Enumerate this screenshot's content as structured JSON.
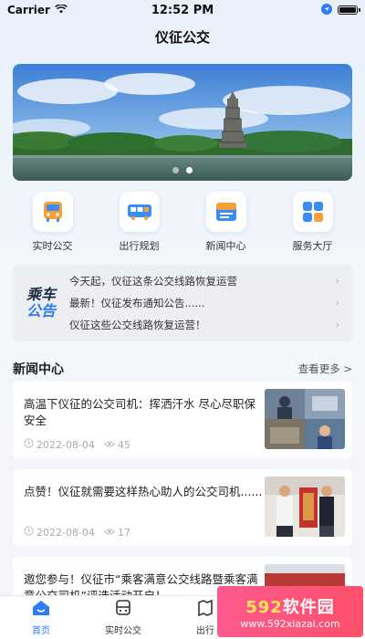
{
  "status_bar": {
    "carrier": "Carrier",
    "time": "12:52 PM"
  },
  "header": {
    "title": "仪征公交"
  },
  "banner": {
    "slide_count": 2,
    "active_slide": 2
  },
  "quick_menu": [
    {
      "label": "实时公交",
      "icon": "bus-icon"
    },
    {
      "label": "出行规划",
      "icon": "route-plan-icon"
    },
    {
      "label": "新闻中心",
      "icon": "news-icon"
    },
    {
      "label": "服务大厅",
      "icon": "service-grid-icon"
    }
  ],
  "notice": {
    "badge_line1": "乘车",
    "badge_line2": "公告",
    "items": [
      "今天起，仪征这条公交线路恢复运营",
      "最新！仪征发布通知公告......",
      "仪征这些公交线路恢复运营！"
    ]
  },
  "news_section": {
    "title": "新闻中心",
    "more": "查看更多 >",
    "items": [
      {
        "title": "高温下仪征的公交司机：挥洒汗水 尽心尽职保安全",
        "date": "2022-08-04",
        "views": "45"
      },
      {
        "title": "点赞！仪征就需要这样热心助人的公交司机......",
        "date": "2022-08-04",
        "views": "17"
      },
      {
        "title": "邀您参与！仪征市“乘客满意公交线路暨乘客满意公交司机”评选活动开启！",
        "date": "",
        "views": ""
      }
    ]
  },
  "tab_bar": [
    {
      "label": "首页",
      "active": true
    },
    {
      "label": "实时公交",
      "active": false
    },
    {
      "label": "出行",
      "active": false
    }
  ],
  "watermark": {
    "number": "592",
    "text": "软件园",
    "url": "www.592xiazai.com"
  },
  "colors": {
    "accent": "#2d7cf6",
    "background": "#f4f5f8",
    "watermark": "#fc5a8d"
  }
}
